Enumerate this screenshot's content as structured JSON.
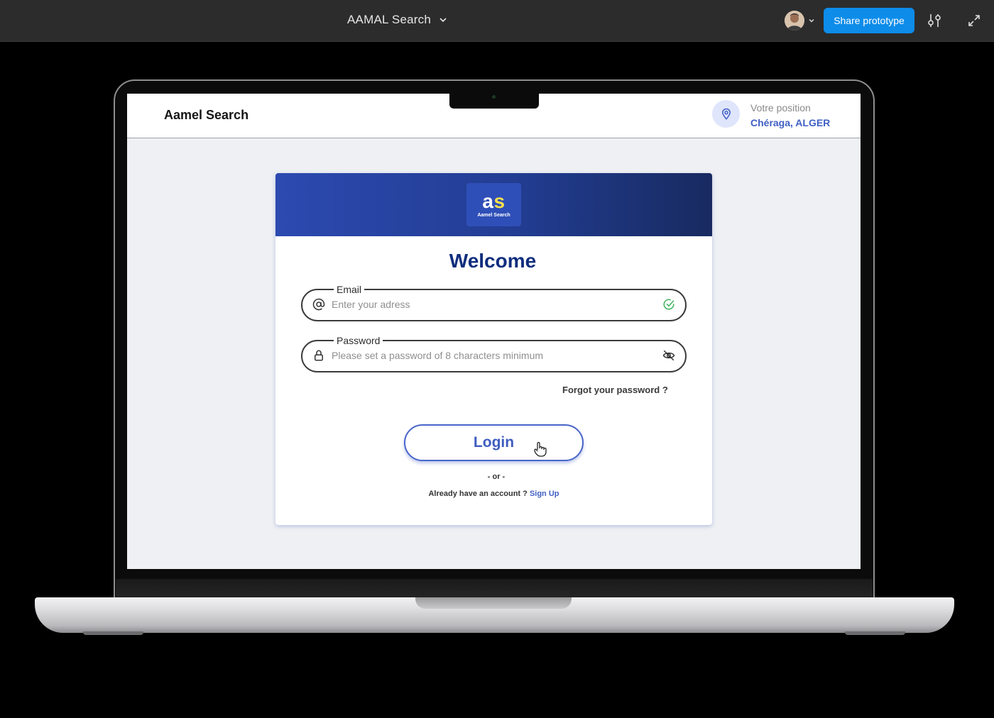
{
  "topbar": {
    "prototype_title": "AAMAL Search",
    "share_label": "Share prototype"
  },
  "app": {
    "name": "Aamel Search",
    "location": {
      "label": "Votre position",
      "value": "Chéraga, ALGER"
    }
  },
  "login": {
    "logo_mark_a": "a",
    "logo_mark_s": "s",
    "logo_subtitle": "Aamel Search",
    "welcome": "Welcome",
    "email": {
      "label": "Email",
      "placeholder": "Enter your adress"
    },
    "password": {
      "label": "Password",
      "placeholder": "Please set a password of 8 characters minimum"
    },
    "forgot_label": "Forgot your password ?",
    "login_label": "Login",
    "or_label": "- or -",
    "account_prompt": "Already have an account ?",
    "signup_label": "Sign Up"
  },
  "colors": {
    "brand_blue": "#0f2d7d",
    "accent_blue": "#3f5fc4",
    "banner_start": "#2c4ab0",
    "banner_end": "#182a60",
    "logo_s_yellow": "#f7e24b",
    "valid_green": "#3cb35a",
    "share_button": "#0d8ce9"
  },
  "icons": {
    "email": "at-sign-icon",
    "email_status": "check-circle-icon",
    "password": "lock-icon",
    "password_toggle": "eye-off-icon",
    "location": "map-pin-icon",
    "cursor": "hand-pointer-icon"
  }
}
